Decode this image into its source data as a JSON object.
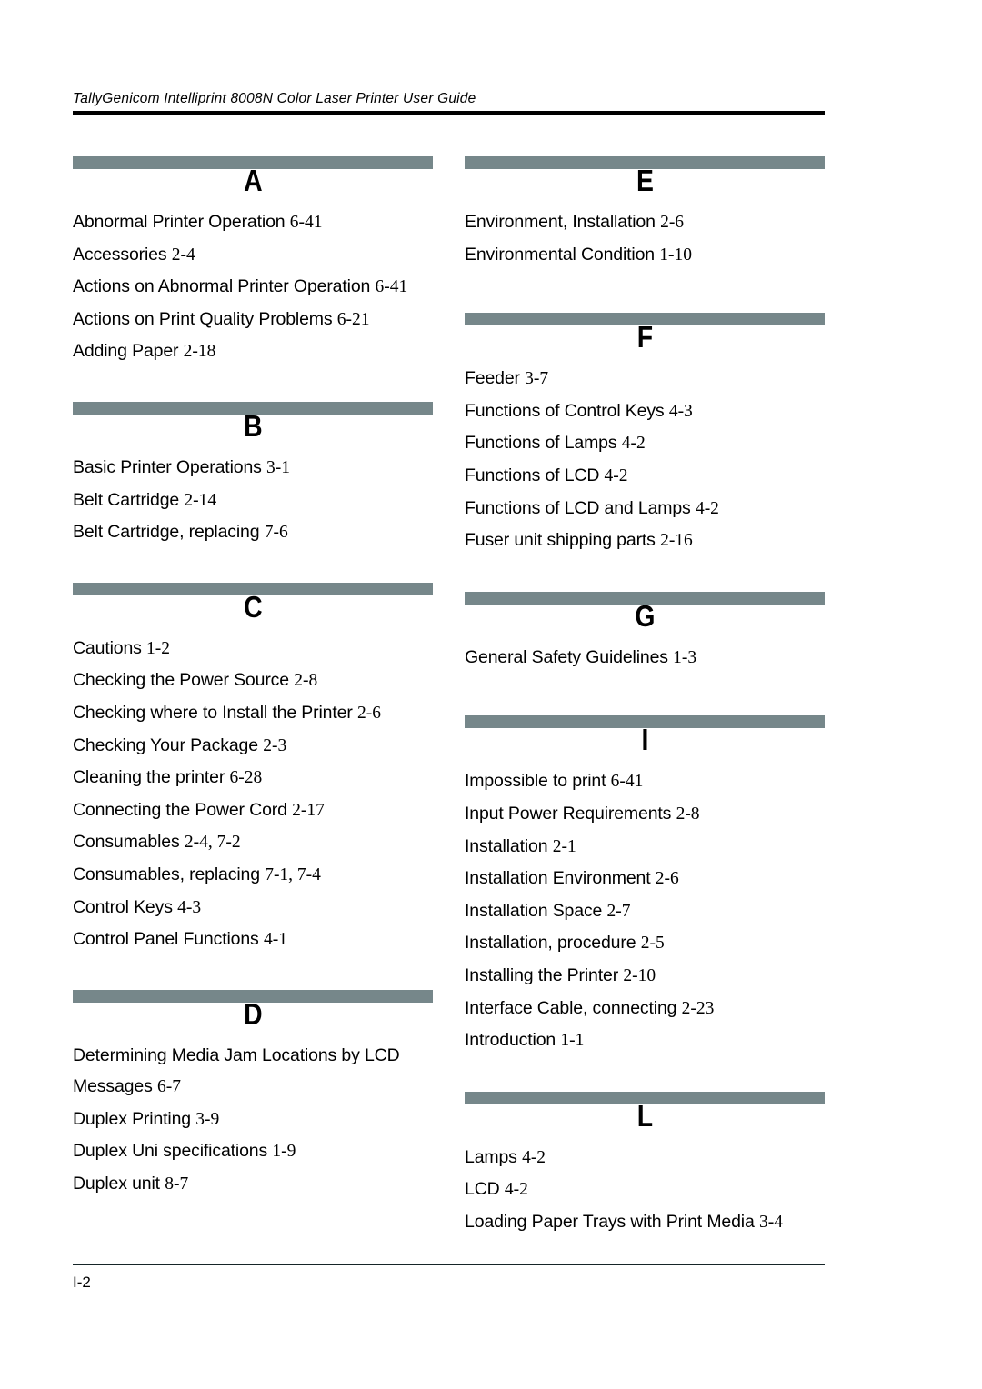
{
  "document": {
    "running_header": "TallyGenicom Intelliprint 8008N Color Laser Printer User Guide",
    "footer_page": "I-2",
    "bar_color": "#76878a",
    "rule_color": "#000000"
  },
  "columns": {
    "left": [
      {
        "letter": "A",
        "entries": [
          {
            "title": "Abnormal Printer Operation",
            "ref": "6-41"
          },
          {
            "title": "Accessories",
            "ref": "2-4"
          },
          {
            "title": "Actions on Abnormal Printer Operation",
            "ref": "6-41"
          },
          {
            "title": "Actions on Print Quality Problems",
            "ref": "6-21"
          },
          {
            "title": "Adding Paper",
            "ref": "2-18"
          }
        ]
      },
      {
        "letter": "B",
        "entries": [
          {
            "title": "Basic Printer Operations",
            "ref": "3-1"
          },
          {
            "title": "Belt Cartridge",
            "ref": "2-14"
          },
          {
            "title": "Belt Cartridge, replacing",
            "ref": "7-6"
          }
        ]
      },
      {
        "letter": "C",
        "entries": [
          {
            "title": "Cautions",
            "ref": "1-2"
          },
          {
            "title": "Checking the Power Source",
            "ref": "2-8"
          },
          {
            "title": "Checking where to Install the Printer",
            "ref": "2-6"
          },
          {
            "title": "Checking Your Package",
            "ref": "2-3"
          },
          {
            "title": "Cleaning the printer",
            "ref": "6-28"
          },
          {
            "title": "Connecting the Power Cord",
            "ref": "2-17"
          },
          {
            "title": "Consumables",
            "ref": "2-4, 7-2"
          },
          {
            "title": "Consumables, replacing",
            "ref": "7-1, 7-4"
          },
          {
            "title": "Control Keys",
            "ref": "4-3"
          },
          {
            "title": "Control Panel Functions",
            "ref": "4-1"
          }
        ]
      },
      {
        "letter": "D",
        "entries": [
          {
            "title": "Determining Media Jam Locations by LCD Messages",
            "ref": "6-7"
          },
          {
            "title": "Duplex Printing",
            "ref": "3-9"
          },
          {
            "title": "Duplex Uni specifications",
            "ref": "1-9"
          },
          {
            "title": "Duplex unit",
            "ref": "8-7"
          }
        ]
      }
    ],
    "right": [
      {
        "letter": "E",
        "entries": [
          {
            "title": "Environment, Installation",
            "ref": "2-6"
          },
          {
            "title": "Environmental Condition",
            "ref": "1-10"
          }
        ]
      },
      {
        "letter": "F",
        "entries": [
          {
            "title": "Feeder",
            "ref": "3-7"
          },
          {
            "title": "Functions of Control Keys",
            "ref": "4-3"
          },
          {
            "title": "Functions of Lamps",
            "ref": "4-2"
          },
          {
            "title": "Functions of LCD",
            "ref": "4-2"
          },
          {
            "title": "Functions of LCD and Lamps",
            "ref": "4-2"
          },
          {
            "title": "Fuser unit shipping parts",
            "ref": "2-16"
          }
        ]
      },
      {
        "letter": "G",
        "entries": [
          {
            "title": "General Safety Guidelines",
            "ref": "1-3"
          }
        ]
      },
      {
        "letter": "I",
        "entries": [
          {
            "title": "Impossible to print",
            "ref": "6-41"
          },
          {
            "title": "Input Power Requirements",
            "ref": "2-8"
          },
          {
            "title": "Installation",
            "ref": "2-1"
          },
          {
            "title": "Installation Environment",
            "ref": "2-6"
          },
          {
            "title": "Installation Space",
            "ref": "2-7"
          },
          {
            "title": "Installation, procedure",
            "ref": "2-5"
          },
          {
            "title": "Installing the Printer",
            "ref": "2-10"
          },
          {
            "title": "Interface Cable, connecting",
            "ref": "2-23"
          },
          {
            "title": "Introduction",
            "ref": "1-1"
          }
        ]
      },
      {
        "letter": "L",
        "entries": [
          {
            "title": "Lamps",
            "ref": "4-2"
          },
          {
            "title": "LCD",
            "ref": "4-2"
          },
          {
            "title": "Loading Paper Trays with Print Media",
            "ref": "3-4"
          }
        ]
      }
    ]
  }
}
